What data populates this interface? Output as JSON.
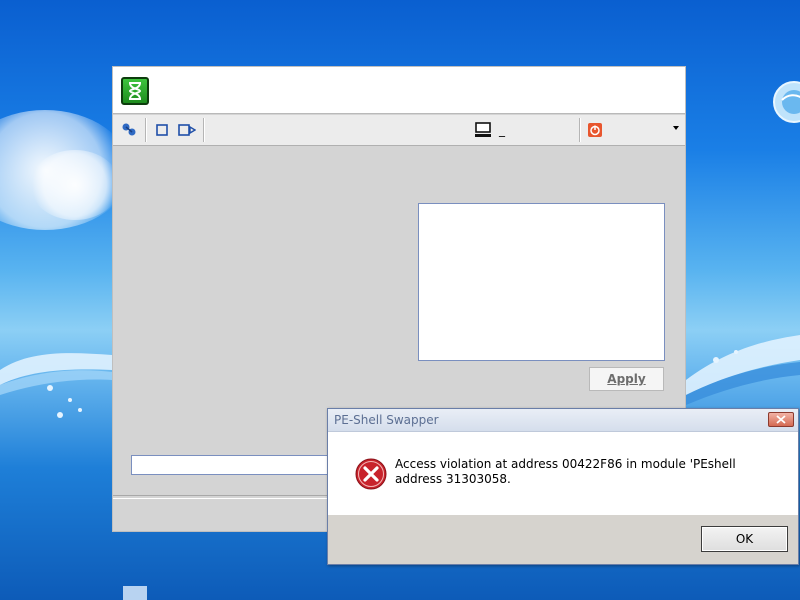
{
  "main_window": {
    "toolbar": {
      "terminal_text": "_"
    },
    "apply_label": "Apply",
    "path_value": ""
  },
  "dialog": {
    "title": "PE-Shell Swapper",
    "message": "Access violation at address 00422F86 in module 'PEshell\naddress 31303058.",
    "ok_label": "OK",
    "icon": "error-icon"
  },
  "icons": {
    "app": "hourglass-icon",
    "toolbar": [
      "network-icon",
      "stop-icon",
      "record-icon",
      "computer-icon",
      "power-icon"
    ],
    "desktop": "globe-icon"
  },
  "colors": {
    "accent_green": "#1e8c1e",
    "error_red": "#c8232c",
    "dialog_title": "#5c6f93"
  }
}
